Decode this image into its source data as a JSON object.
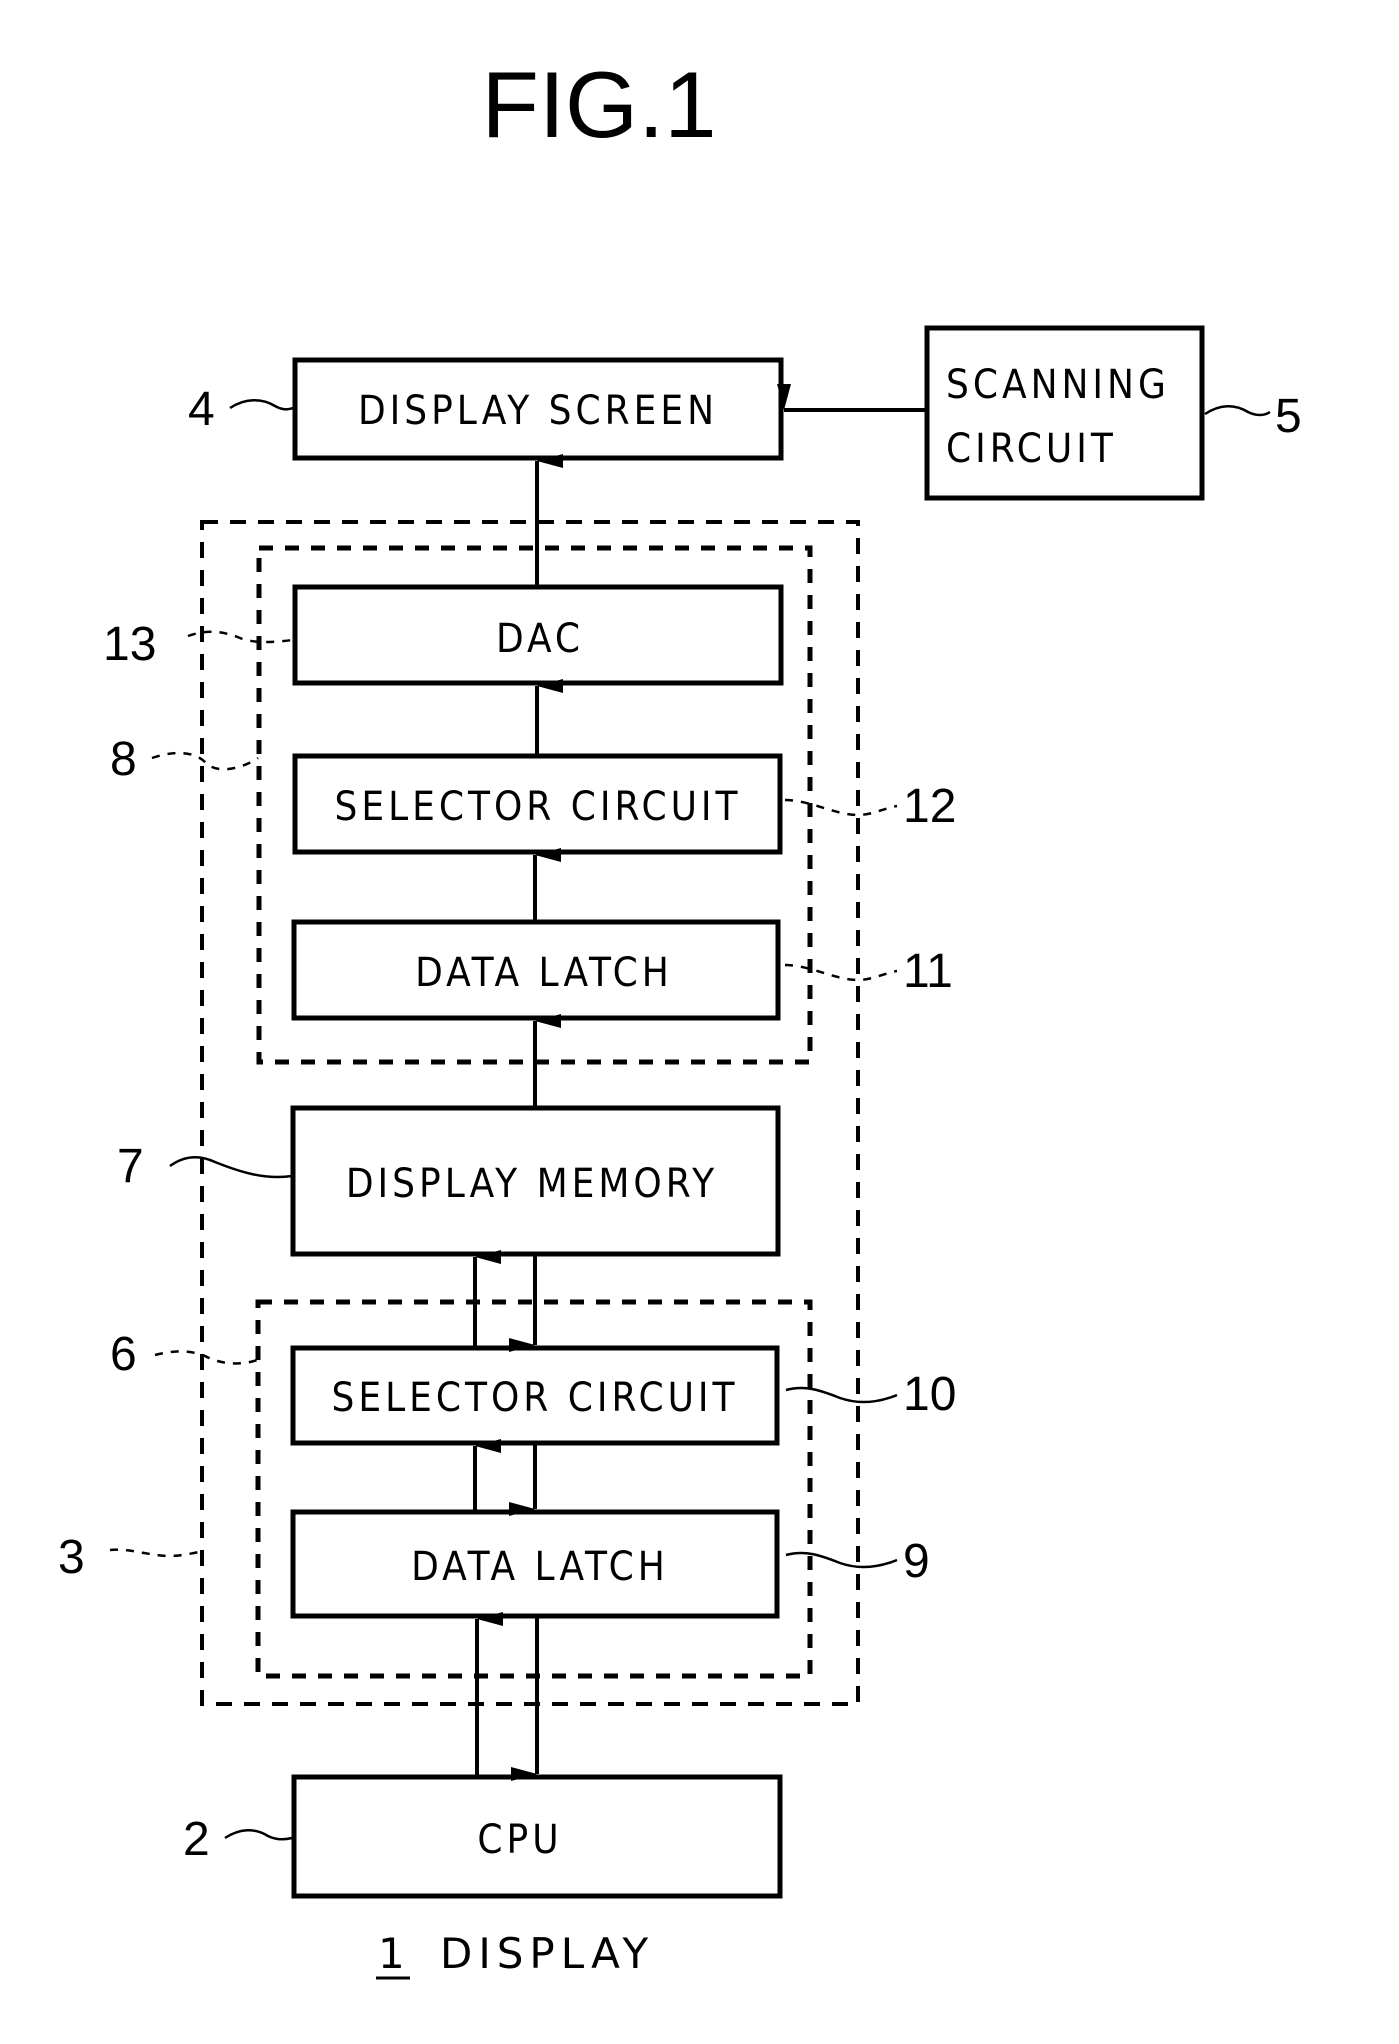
{
  "figure": {
    "title": "FIG.1",
    "caption_ref": "1",
    "caption_text": "DISPLAY"
  },
  "blocks": {
    "display_screen": {
      "label": "DISPLAY SCREEN",
      "ref": "4"
    },
    "scanning_circuit": {
      "label_line1": "SCANNING",
      "label_line2": "CIRCUIT",
      "ref": "5"
    },
    "dac": {
      "label": "DAC",
      "ref": "13"
    },
    "selector_circuit_out": {
      "label": "SELECTOR CIRCUIT",
      "ref": "12"
    },
    "data_latch_out": {
      "label": "DATA LATCH",
      "ref": "11"
    },
    "display_memory": {
      "label": "DISPLAY MEMORY",
      "ref": "7"
    },
    "selector_circuit_in": {
      "label": "SELECTOR CIRCUIT",
      "ref": "10"
    },
    "data_latch_in": {
      "label": "DATA LATCH",
      "ref": "9"
    },
    "cpu": {
      "label": "CPU",
      "ref": "2"
    }
  },
  "groups": {
    "controller": {
      "ref": "3"
    },
    "output_circuit": {
      "ref": "8"
    },
    "input_circuit": {
      "ref": "6"
    }
  },
  "connections": [
    {
      "from": "scanning_circuit",
      "to": "display_screen",
      "direction": "one-way"
    },
    {
      "from": "dac",
      "to": "display_screen",
      "direction": "one-way"
    },
    {
      "from": "selector_circuit_out",
      "to": "dac",
      "direction": "one-way"
    },
    {
      "from": "data_latch_out",
      "to": "selector_circuit_out",
      "direction": "one-way"
    },
    {
      "from": "display_memory",
      "to": "data_latch_out",
      "direction": "one-way"
    },
    {
      "from": "selector_circuit_in",
      "to": "display_memory",
      "direction": "bidirectional"
    },
    {
      "from": "data_latch_in",
      "to": "selector_circuit_in",
      "direction": "bidirectional"
    },
    {
      "from": "cpu",
      "to": "data_latch_in",
      "direction": "bidirectional"
    }
  ]
}
